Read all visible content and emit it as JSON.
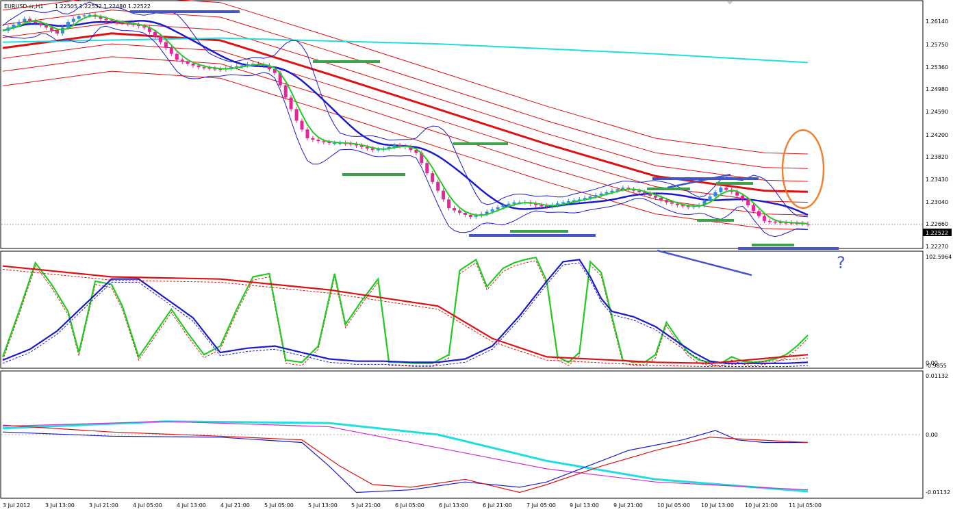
{
  "header": {
    "symbol": "EURUSD.cr,H1",
    "ohlc": "1.22505 1.22532 1.22480 1.22522"
  },
  "main_panel": {
    "price_ticks": [
      "1.26140",
      "1.25750",
      "1.25360",
      "1.24980",
      "1.24590",
      "1.24200",
      "1.23820",
      "1.23430",
      "1.23040",
      "1.22660",
      "1.22270"
    ],
    "current_price": "1.22522"
  },
  "osc_panel": {
    "max_label": "102.5964",
    "min_labels": [
      "0.00",
      "-0.9855"
    ]
  },
  "macd_panel": {
    "ticks": [
      "0.01132",
      "0.00",
      "-0.01132"
    ]
  },
  "time_axis": [
    "3 Jul 2012",
    "3 Jul 13:00",
    "3 Jul 21:00",
    "4 Jul 05:00",
    "4 Jul 13:00",
    "4 Jul 21:00",
    "5 Jul 05:00",
    "5 Jul 13:00",
    "5 Jul 21:00",
    "6 Jul 05:00",
    "6 Jul 13:00",
    "6 Jul 21:00",
    "7 Jul 05:00",
    "9 Jul 13:00",
    "9 Jul 21:00",
    "10 Jul 05:00",
    "10 Jul 13:00",
    "10 Jul 21:00",
    "11 Jul 05:00"
  ],
  "annotations": {
    "question_mark": "?"
  },
  "colors": {
    "bull": "#2f8be0",
    "bear": "#e8249a",
    "green": "#22cc22",
    "blue": "#1a1acc",
    "red": "#dd1111",
    "cyan": "#22dddd",
    "magenta": "#cc33cc",
    "annot_green": "#3aa24a",
    "annot_blue": "#4455cc",
    "orange": "#f08030"
  },
  "chart_data": [
    {
      "type": "candlestick",
      "panel": "price",
      "title": "EURUSD.cr,H1",
      "ylim": [
        1.2212,
        1.2635
      ],
      "x_categories": [
        "3 Jul 2012",
        "3 Jul 13:00",
        "3 Jul 21:00",
        "4 Jul 05:00",
        "4 Jul 13:00",
        "4 Jul 21:00",
        "5 Jul 05:00",
        "5 Jul 13:00",
        "5 Jul 21:00",
        "6 Jul 05:00",
        "6 Jul 13:00",
        "6 Jul 21:00",
        "7 Jul 05:00",
        "9 Jul 13:00",
        "9 Jul 21:00",
        "10 Jul 05:00",
        "10 Jul 13:00",
        "10 Jul 21:00",
        "11 Jul 05:00"
      ],
      "close_path": [
        [
          0,
          1.2585
        ],
        [
          2,
          1.2595
        ],
        [
          4,
          1.2605
        ],
        [
          6,
          1.2598
        ],
        [
          8,
          1.259
        ],
        [
          10,
          1.258
        ],
        [
          12,
          1.26
        ],
        [
          14,
          1.261
        ],
        [
          16,
          1.2612
        ],
        [
          18,
          1.2605
        ],
        [
          20,
          1.26
        ],
        [
          22,
          1.2598
        ],
        [
          24,
          1.2595
        ],
        [
          26,
          1.259
        ],
        [
          28,
          1.2575
        ],
        [
          30,
          1.2555
        ],
        [
          32,
          1.2535
        ],
        [
          34,
          1.2528
        ],
        [
          36,
          1.2522
        ],
        [
          38,
          1.252
        ],
        [
          40,
          1.2518
        ],
        [
          42,
          1.2522
        ],
        [
          44,
          1.2525
        ],
        [
          46,
          1.2528
        ],
        [
          48,
          1.2525
        ],
        [
          50,
          1.2512
        ],
        [
          52,
          1.247
        ],
        [
          54,
          1.243
        ],
        [
          56,
          1.24
        ],
        [
          58,
          1.2395
        ],
        [
          60,
          1.2392
        ],
        [
          62,
          1.2392
        ],
        [
          64,
          1.239
        ],
        [
          66,
          1.2385
        ],
        [
          68,
          1.238
        ],
        [
          70,
          1.2382
        ],
        [
          72,
          1.2388
        ],
        [
          74,
          1.2385
        ],
        [
          76,
          1.2375
        ],
        [
          78,
          1.234
        ],
        [
          80,
          1.231
        ],
        [
          82,
          1.228
        ],
        [
          84,
          1.2272
        ],
        [
          86,
          1.2265
        ],
        [
          88,
          1.227
        ],
        [
          90,
          1.2278
        ],
        [
          92,
          1.2285
        ],
        [
          94,
          1.229
        ],
        [
          96,
          1.229
        ],
        [
          98,
          1.2285
        ],
        [
          100,
          1.2283
        ],
        [
          102,
          1.2288
        ],
        [
          104,
          1.2292
        ],
        [
          106,
          1.2295
        ],
        [
          108,
          1.23
        ],
        [
          110,
          1.2305
        ],
        [
          112,
          1.231
        ],
        [
          114,
          1.2315
        ],
        [
          116,
          1.231
        ],
        [
          118,
          1.2305
        ],
        [
          120,
          1.2298
        ],
        [
          122,
          1.229
        ],
        [
          124,
          1.2285
        ],
        [
          126,
          1.2282
        ],
        [
          128,
          1.2285
        ],
        [
          130,
          1.23
        ],
        [
          132,
          1.2315
        ],
        [
          134,
          1.2308
        ],
        [
          136,
          1.2295
        ],
        [
          138,
          1.2275
        ],
        [
          140,
          1.2258
        ],
        [
          142,
          1.2256
        ],
        [
          144,
          1.2255
        ],
        [
          146,
          1.2254
        ],
        [
          148,
          1.2252
        ]
      ],
      "last_close": 1.22522
    },
    {
      "type": "line",
      "panel": "stochastic-oscillator",
      "ylim": [
        0,
        102.5964
      ],
      "series": [
        {
          "key": "green",
          "values": [
            [
              0,
              8
            ],
            [
              3,
              50
            ],
            [
              6,
              95
            ],
            [
              9,
              75
            ],
            [
              12,
              50
            ],
            [
              14,
              12
            ],
            [
              17,
              78
            ],
            [
              20,
              75
            ],
            [
              22,
              55
            ],
            [
              25,
              8
            ],
            [
              28,
              30
            ],
            [
              31,
              52
            ],
            [
              34,
              30
            ],
            [
              37,
              10
            ],
            [
              40,
              18
            ],
            [
              43,
              52
            ],
            [
              46,
              82
            ],
            [
              49,
              85
            ],
            [
              52,
              5
            ],
            [
              55,
              3
            ],
            [
              58,
              18
            ],
            [
              61,
              85
            ],
            [
              63,
              38
            ],
            [
              66,
              60
            ],
            [
              69,
              80
            ],
            [
              71,
              3
            ],
            [
              73,
              3
            ],
            [
              76,
              2
            ],
            [
              79,
              2
            ],
            [
              82,
              10
            ],
            [
              84,
              88
            ],
            [
              87,
              98
            ],
            [
              89,
              73
            ],
            [
              92,
              90
            ],
            [
              94,
              95
            ],
            [
              96,
              98
            ],
            [
              98,
              100
            ],
            [
              100,
              78
            ],
            [
              102,
              8
            ],
            [
              104,
              3
            ],
            [
              106,
              12
            ],
            [
              108,
              96
            ],
            [
              110,
              86
            ],
            [
              112,
              45
            ],
            [
              114,
              5
            ],
            [
              116,
              3
            ],
            [
              118,
              3
            ],
            [
              120,
              10
            ],
            [
              122,
              40
            ],
            [
              124,
              25
            ],
            [
              126,
              12
            ],
            [
              128,
              5
            ],
            [
              130,
              3
            ],
            [
              132,
              2
            ],
            [
              134,
              8
            ],
            [
              136,
              4
            ],
            [
              138,
              3
            ],
            [
              140,
              4
            ],
            [
              142,
              6
            ],
            [
              144,
              10
            ],
            [
              146,
              18
            ],
            [
              148,
              28
            ]
          ]
        },
        {
          "key": "blue",
          "values": [
            [
              0,
              5
            ],
            [
              5,
              15
            ],
            [
              10,
              32
            ],
            [
              15,
              56
            ],
            [
              20,
              80
            ],
            [
              25,
              80
            ],
            [
              30,
              62
            ],
            [
              35,
              44
            ],
            [
              40,
              12
            ],
            [
              45,
              16
            ],
            [
              50,
              18
            ],
            [
              55,
              12
            ],
            [
              60,
              6
            ],
            [
              65,
              4
            ],
            [
              70,
              4
            ],
            [
              75,
              3
            ],
            [
              80,
              3
            ],
            [
              85,
              6
            ],
            [
              90,
              18
            ],
            [
              95,
              46
            ],
            [
              100,
              78
            ],
            [
              103,
              96
            ],
            [
              106,
              98
            ],
            [
              108,
              82
            ],
            [
              110,
              62
            ],
            [
              112,
              50
            ],
            [
              116,
              45
            ],
            [
              120,
              36
            ],
            [
              124,
              22
            ],
            [
              127,
              12
            ],
            [
              130,
              4
            ],
            [
              133,
              2
            ],
            [
              136,
              2
            ],
            [
              140,
              2
            ],
            [
              144,
              2
            ],
            [
              148,
              3
            ]
          ]
        },
        {
          "key": "red",
          "values": [
            [
              0,
              92
            ],
            [
              20,
              82
            ],
            [
              40,
              80
            ],
            [
              60,
              70
            ],
            [
              80,
              55
            ],
            [
              90,
              25
            ],
            [
              100,
              8
            ],
            [
              120,
              3
            ],
            [
              130,
              2
            ],
            [
              148,
              10
            ]
          ]
        }
      ]
    },
    {
      "type": "line",
      "panel": "macd",
      "ylim": [
        -0.01132,
        0.01132
      ],
      "series": [
        {
          "key": "cyan",
          "values": [
            [
              0,
              0.0012
            ],
            [
              30,
              0.0025
            ],
            [
              60,
              0.0022
            ],
            [
              80,
              0.0
            ],
            [
              100,
              -0.005
            ],
            [
              120,
              -0.0085
            ],
            [
              148,
              -0.0108
            ]
          ]
        },
        {
          "key": "magenta",
          "values": [
            [
              0,
              0.0016
            ],
            [
              30,
              0.0025
            ],
            [
              60,
              0.0015
            ],
            [
              80,
              -0.0025
            ],
            [
              100,
              -0.0065
            ],
            [
              120,
              -0.009
            ],
            [
              148,
              -0.0105
            ]
          ]
        },
        {
          "key": "blue",
          "values": [
            [
              0,
              0.0005
            ],
            [
              20,
              -0.0003
            ],
            [
              40,
              -0.0005
            ],
            [
              55,
              -0.0015
            ],
            [
              60,
              -0.006
            ],
            [
              65,
              -0.011
            ],
            [
              75,
              -0.0105
            ],
            [
              85,
              -0.009
            ],
            [
              95,
              -0.01
            ],
            [
              100,
              -0.009
            ],
            [
              105,
              -0.007
            ],
            [
              115,
              -0.003
            ],
            [
              125,
              -0.001
            ],
            [
              131,
              0.0008
            ],
            [
              135,
              -0.001
            ],
            [
              140,
              -0.0015
            ],
            [
              148,
              -0.0015
            ]
          ]
        },
        {
          "key": "red",
          "values": [
            [
              0,
              0.0018
            ],
            [
              20,
              0.0005
            ],
            [
              40,
              -0.0003
            ],
            [
              55,
              -0.001
            ],
            [
              62,
              -0.006
            ],
            [
              68,
              -0.0095
            ],
            [
              75,
              -0.01
            ],
            [
              85,
              -0.0085
            ],
            [
              95,
              -0.011
            ],
            [
              100,
              -0.0095
            ],
            [
              110,
              -0.006
            ],
            [
              120,
              -0.003
            ],
            [
              130,
              -0.0005
            ],
            [
              135,
              -0.0008
            ],
            [
              148,
              -0.0015
            ]
          ]
        }
      ]
    }
  ]
}
